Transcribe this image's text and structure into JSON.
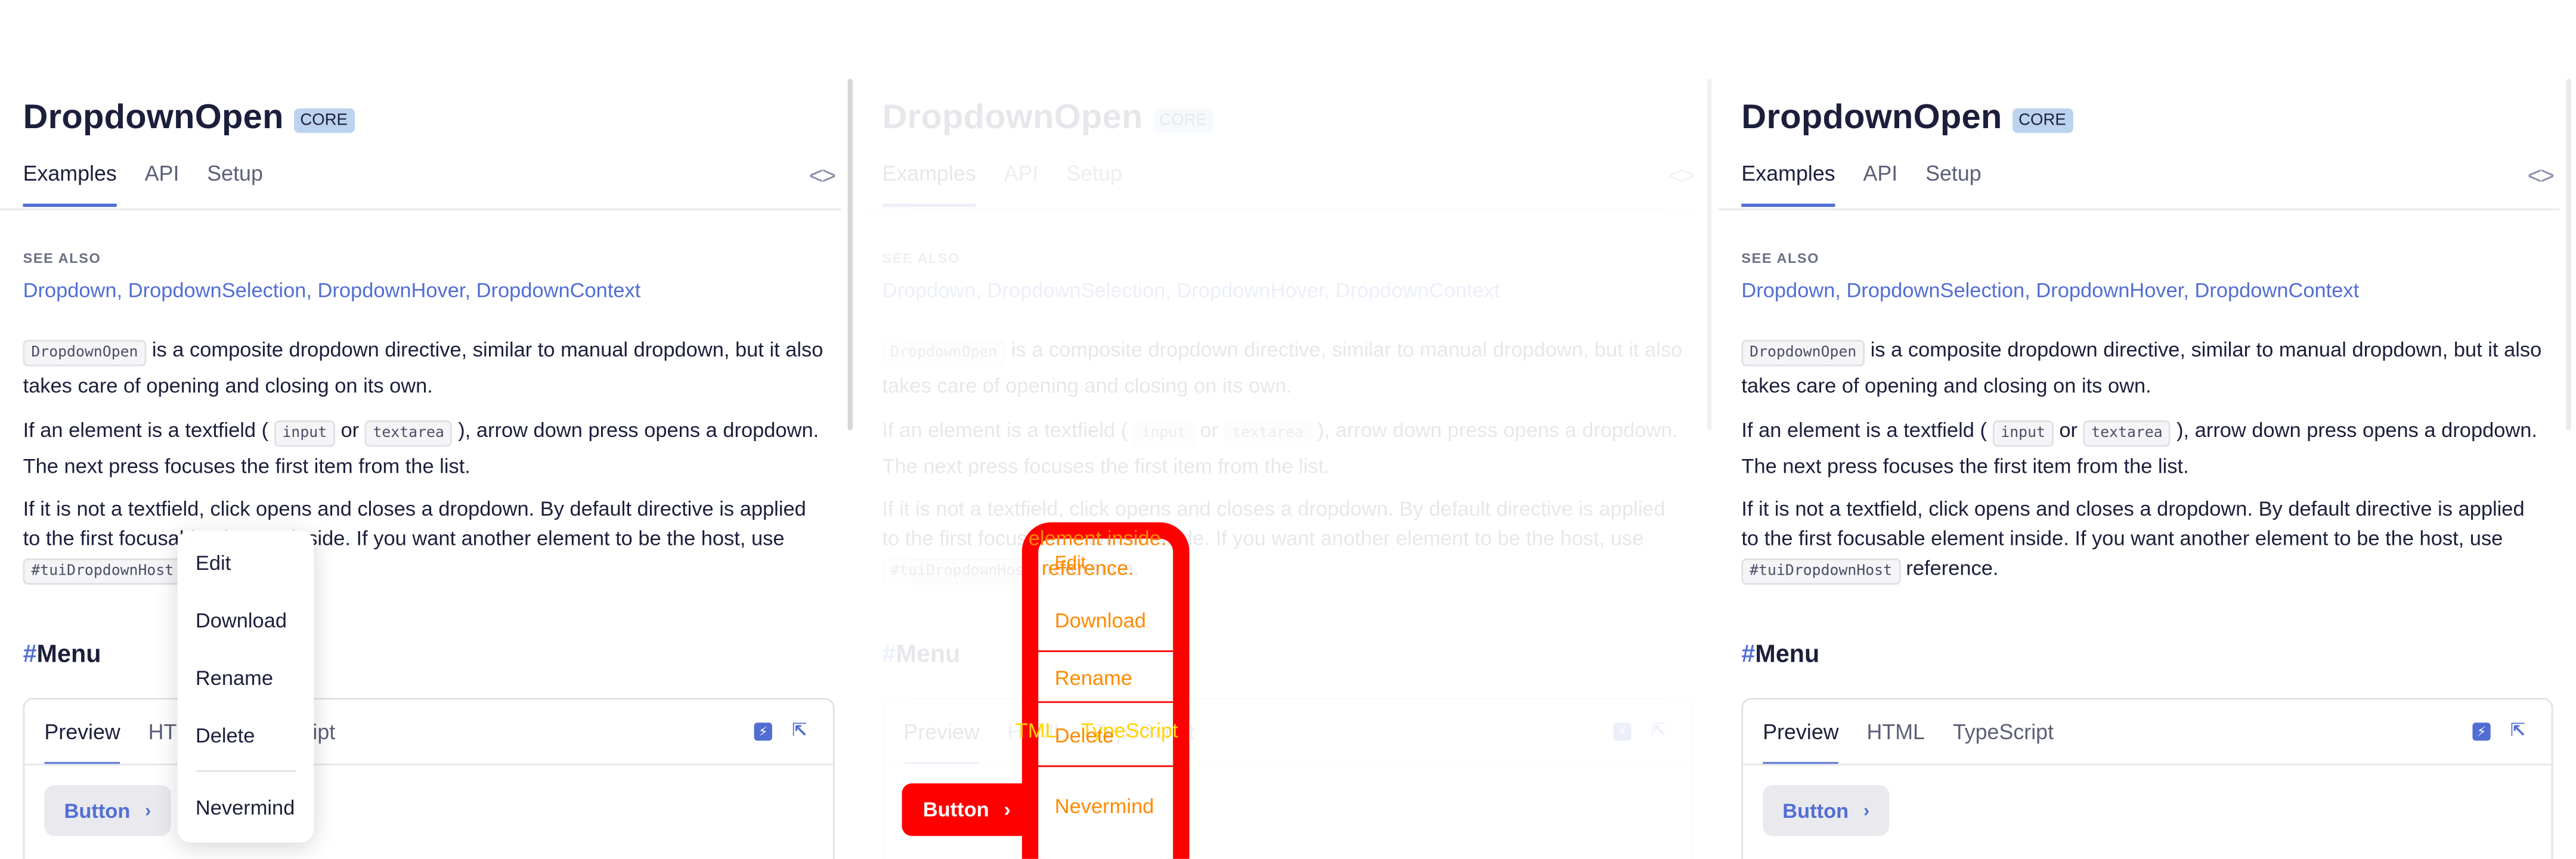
{
  "docs": {
    "page_title": "DropdownOpen",
    "badge": "CORE",
    "tabs": [
      "Examples",
      "API",
      "Setup"
    ],
    "code_toggle_icon": "code-brackets-icon",
    "see_also_title": "SEE ALSO",
    "see_also_links": [
      "Dropdown",
      "DropdownSelection",
      "DropdownHover",
      "DropdownContext"
    ],
    "see_also_separator": ", ",
    "p1": {
      "code": "DropdownOpen",
      "text": " is a composite dropdown directive, similar to manual dropdown, but it also takes care of opening and closing on its own."
    },
    "p2": {
      "text1": "If an element is a textfield ( ",
      "code1": "input",
      "text2": " or ",
      "code2": "textarea",
      "text3": " ), arrow down press opens a dropdown. The next press focuses the first item from the list."
    },
    "p3": {
      "text1": "If it is not a textfield, click opens and closes a dropdown. By default directive is applied to the first focusable element inside. If you want another element to be the host, use ",
      "code": "#tuiDropdownHost",
      "text2": " reference."
    },
    "section": {
      "hash": "#",
      "title": "Menu"
    },
    "demo": {
      "tabs": [
        "Preview",
        "HTML",
        "TypeScript"
      ],
      "button_label": "Button",
      "icons": [
        "stackblitz-icon",
        "expand-icon"
      ]
    }
  },
  "dropdown_menu": {
    "items": [
      "Edit",
      "Download",
      "Rename",
      "Delete",
      "Nevermind"
    ]
  },
  "overlay": {
    "text_inside": "element inside.",
    "text_reference": "reference.",
    "tab_fragment": "TML",
    "tab_typescript": "TypeScript",
    "accent": "#ff0000",
    "text_color": "#ff8a00"
  },
  "colors": {
    "accent": "#526ed3",
    "text": "#1b1f3b",
    "badge_bg": "#bcd3f0"
  }
}
